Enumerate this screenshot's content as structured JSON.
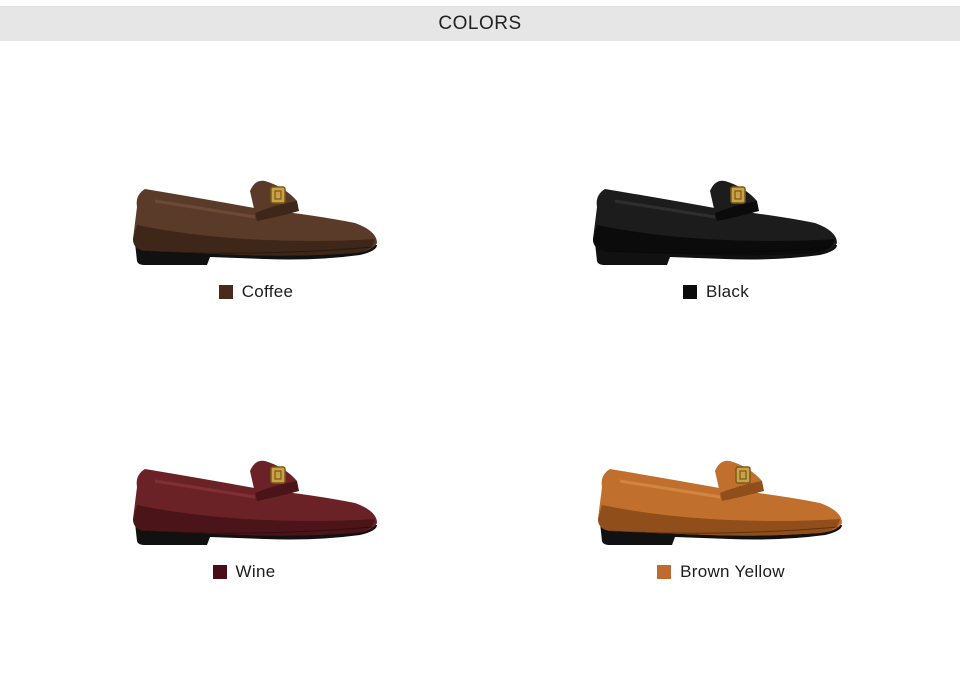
{
  "header": {
    "title": "COLORS"
  },
  "colors": [
    {
      "name": "Coffee",
      "swatch": "#4a2a1c",
      "upper": "#5a3a29",
      "upper_dark": "#3e2619",
      "highlight": "#7a5540"
    },
    {
      "name": "Black",
      "swatch": "#0a0a0a",
      "upper": "#1c1c1c",
      "upper_dark": "#0b0b0b",
      "highlight": "#3a3a3a"
    },
    {
      "name": "Wine",
      "swatch": "#4a0d18",
      "upper": "#6b2226",
      "upper_dark": "#4a1419",
      "highlight": "#8c3a3c"
    },
    {
      "name": "Brown Yellow",
      "swatch": "#bf6a2e",
      "upper": "#c0702c",
      "upper_dark": "#8f4e1a",
      "highlight": "#dc9553"
    }
  ]
}
